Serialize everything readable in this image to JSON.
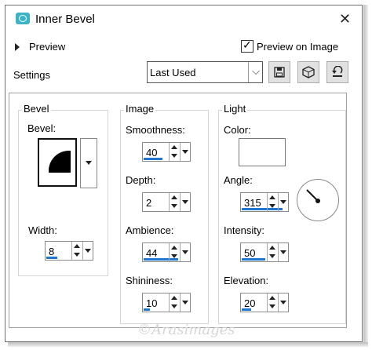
{
  "window": {
    "title": "Inner Bevel",
    "close_label": "✕"
  },
  "preview": {
    "label": "Preview",
    "on_image_label": "Preview on Image",
    "on_image_checked": true,
    "check_mark": "✓"
  },
  "settings": {
    "label": "Settings",
    "preset_value": "Last Used",
    "toolbar_icons": [
      "save-icon",
      "random-dice-icon",
      "reset-icon"
    ]
  },
  "bevel_group": {
    "label": "Bevel",
    "bevel_label": "Bevel:",
    "width_label": "Width:",
    "width_value": "8"
  },
  "image_group": {
    "label": "Image",
    "smoothness_label": "Smoothness:",
    "smoothness_value": "40",
    "depth_label": "Depth:",
    "depth_value": "2",
    "ambience_label": "Ambience:",
    "ambience_value": "44",
    "shininess_label": "Shininess:",
    "shininess_value": "10"
  },
  "light_group": {
    "label": "Light",
    "color_label": "Color:",
    "color_value": "#ffffff",
    "angle_label": "Angle:",
    "angle_value": "315",
    "intensity_label": "Intensity:",
    "intensity_value": "50",
    "elevation_label": "Elevation:",
    "elevation_value": "20"
  },
  "watermark": "©Arasimages",
  "colors": {
    "accent": "#1f77d0",
    "icon": "#3db4c6"
  }
}
